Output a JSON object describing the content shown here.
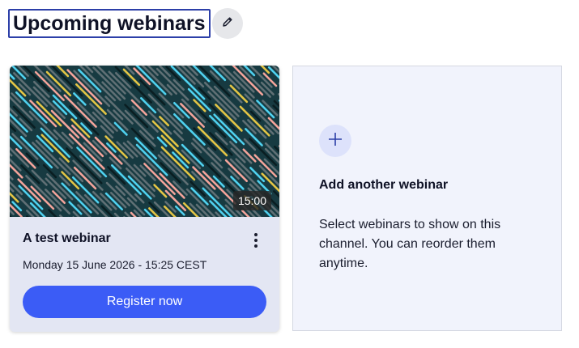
{
  "header": {
    "title": "Upcoming webinars",
    "edit_icon": "pencil-icon"
  },
  "webinar_card": {
    "duration": "15:00",
    "title": "A test webinar",
    "date": "Monday 15 June 2026 - 15:25 CEST",
    "register_label": "Register now",
    "menu_icon": "kebab-menu-icon",
    "thumbnail_colors": [
      "#173a41",
      "#5f6f74",
      "#4fd0ee",
      "#e2c445",
      "#f2a39a",
      "#0a1e22"
    ]
  },
  "add_panel": {
    "icon": "plus-icon",
    "title": "Add another webinar",
    "description": "Select webinars to show on this channel. You can reorder them anytime."
  },
  "colors": {
    "accent": "#3b5cf6",
    "card_bg": "#e3e6f3",
    "panel_bg": "#f1f3fc",
    "title_border": "#2c3fa8"
  }
}
